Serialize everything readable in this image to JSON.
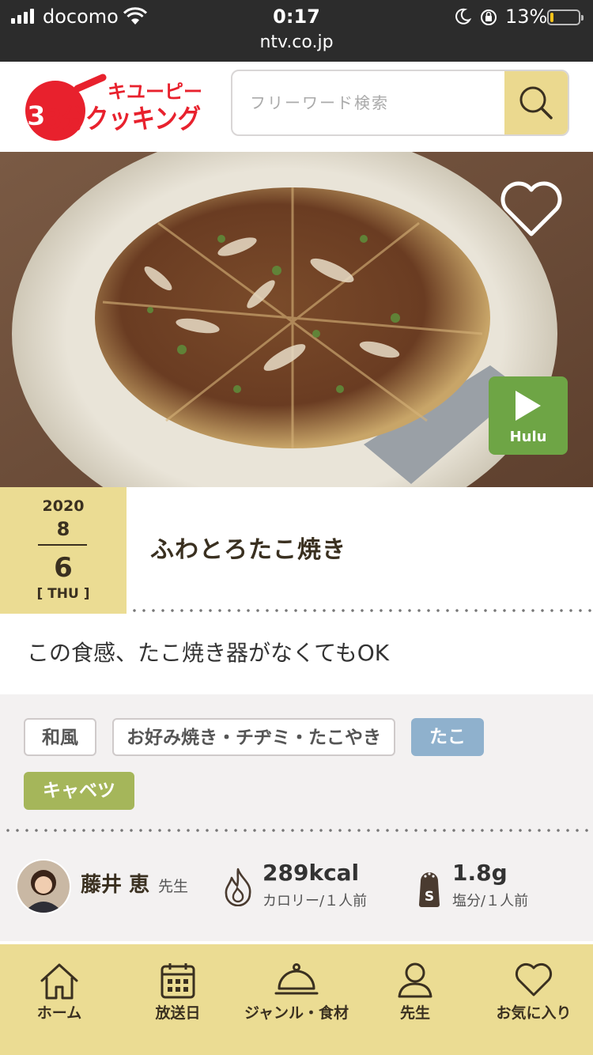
{
  "status_bar": {
    "carrier": "docomo",
    "time": "0:17",
    "battery_percent": "13%",
    "battery_level": 0.13,
    "url": "ntv.co.jp"
  },
  "header": {
    "logo_text_top": "キユーピー",
    "logo_text_main": "3分クッキング",
    "search_placeholder": "フリーワード検索",
    "search_icon": "search-icon",
    "accent_color": "#ebd98f"
  },
  "hero": {
    "favorite_icon": "heart-outline-icon",
    "hulu_label": "Hulu",
    "hulu_color": "#6ea545"
  },
  "recipe": {
    "date": {
      "year": "2020",
      "month": "8",
      "day": "6",
      "weekday": "[ THU ]"
    },
    "title": "ふわとろたこ焼き",
    "description": "この食感、たこ焼き器がなくてもOK",
    "tags": [
      {
        "label": "和風",
        "style": "outline"
      },
      {
        "label": "お好み焼き・チヂミ・たこやき",
        "style": "outline"
      },
      {
        "label": "たこ",
        "style": "blue"
      },
      {
        "label": "キャベツ",
        "style": "green"
      }
    ],
    "teacher": {
      "name": "藤井 恵",
      "suffix": "先生"
    },
    "calories": {
      "value": "289kcal",
      "label": "カロリー/１人前"
    },
    "salt": {
      "value": "1.8g",
      "label": "塩分/１人前",
      "icon_letter": "S"
    }
  },
  "bottom_nav": {
    "items": [
      {
        "label": "ホーム",
        "icon": "home-icon"
      },
      {
        "label": "放送日",
        "icon": "calendar-icon"
      },
      {
        "label": "ジャンル・食材",
        "icon": "cloche-icon"
      },
      {
        "label": "先生",
        "icon": "person-icon"
      },
      {
        "label": "お気に入り",
        "icon": "heart-icon"
      }
    ]
  }
}
